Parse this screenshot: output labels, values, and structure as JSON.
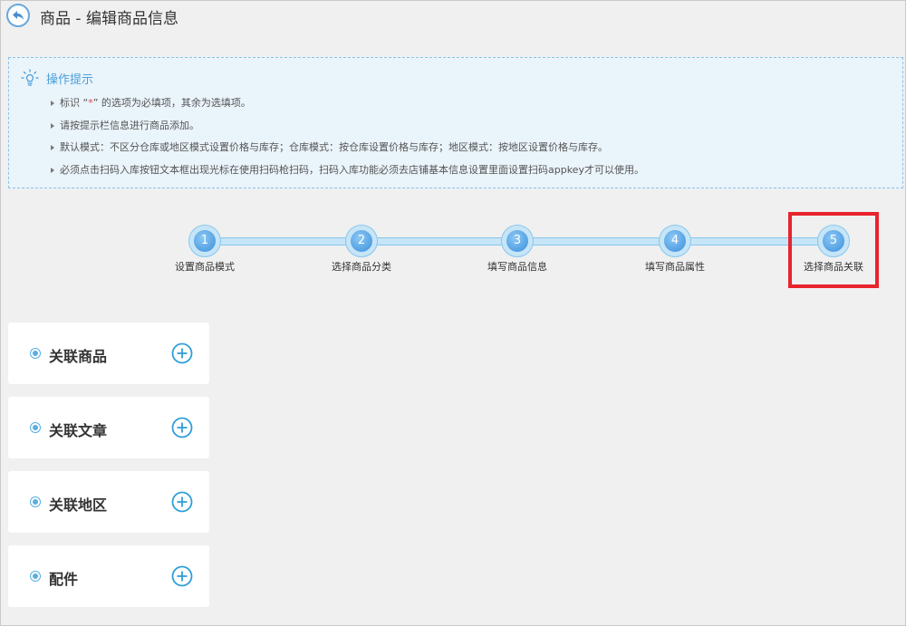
{
  "header": {
    "title": "商品 - 编辑商品信息"
  },
  "tips": {
    "title": "操作提示",
    "items": [
      {
        "before": "标识 “",
        "required_mark": "*",
        "after": "” 的选项为必填项，其余为选填项。"
      },
      {
        "text": "请按提示栏信息进行商品添加。"
      },
      {
        "text": "默认模式：不区分仓库或地区模式设置价格与库存；仓库模式：按仓库设置价格与库存；地区模式：按地区设置价格与库存。"
      },
      {
        "text": "必须点击扫码入库按钮文本框出现光标在使用扫码枪扫码，扫码入库功能必须去店铺基本信息设置里面设置扫码appkey才可以使用。"
      }
    ]
  },
  "steps": [
    {
      "num": "1",
      "label": "设置商品模式"
    },
    {
      "num": "2",
      "label": "选择商品分类"
    },
    {
      "num": "3",
      "label": "填写商品信息"
    },
    {
      "num": "4",
      "label": "填写商品属性"
    },
    {
      "num": "5",
      "label": "选择商品关联"
    }
  ],
  "panels": [
    {
      "title": "关联商品"
    },
    {
      "title": "关联文章"
    },
    {
      "title": "关联地区"
    },
    {
      "title": "配件"
    }
  ],
  "colors": {
    "accent": "#4a9fd8",
    "highlight": "#e8242d",
    "step_fill": "#3b8fdc",
    "background": "#f0f0f0"
  },
  "icons": {
    "back": "back-arrow-icon",
    "tips": "lightbulb-icon",
    "panel_marker": "radio-dot-icon",
    "panel_action": "plus-circle-icon"
  }
}
